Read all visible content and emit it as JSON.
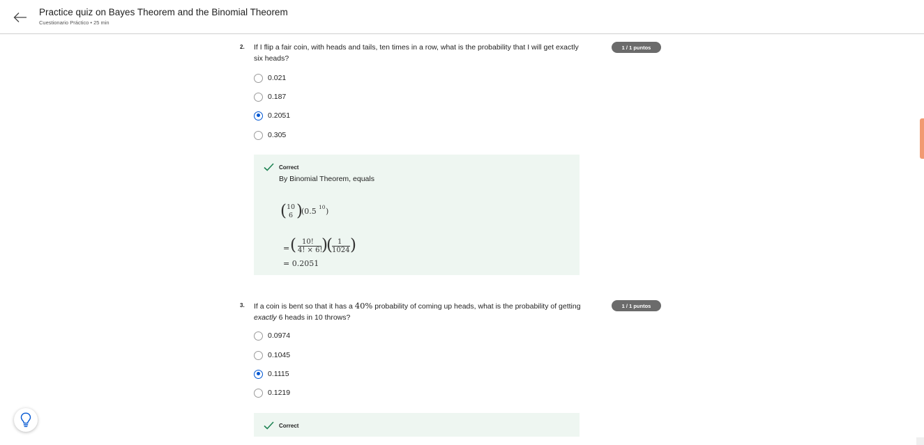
{
  "header": {
    "title": "Practice quiz on Bayes Theorem and the Binomial Theorem",
    "subtitle": "Cuestionario Práctico • 25 min"
  },
  "questions": [
    {
      "number": "2.",
      "text": "If I flip a fair coin, with heads and tails, ten times in a row, what is the probability that I will get exactly six heads?",
      "score": "1 / 1 puntos",
      "options": [
        "0.021",
        "0.187",
        "0.2051",
        "0.305"
      ],
      "selected": "0.2051",
      "feedback": {
        "status": "Correct",
        "text": "By Binomial Theorem, equals",
        "math": {
          "binom_top": "10",
          "binom_bottom": "6",
          "power_expr": "(0.5",
          "power_exp": "10",
          "power_close": ")",
          "eq1": "=",
          "frac1_num": "10!",
          "frac1_den": "4! × 6!",
          "frac2_num": "1",
          "frac2_den": "1024",
          "result": "= 0.2051"
        }
      }
    },
    {
      "number": "3.",
      "text_parts": {
        "a": "If a coin is bent so that it has a ",
        "math": "40%",
        "b": " probability of coming up heads, what is the probability of getting ",
        "em": "exactly",
        "c": " 6 heads in 10 throws?"
      },
      "score": "1 / 1 puntos",
      "options": [
        "0.0974",
        "0.1045",
        "0.1115",
        "0.1219"
      ],
      "selected": "0.1115",
      "feedback": {
        "status": "Correct"
      }
    }
  ],
  "colors": {
    "accent": "#0056d2",
    "correct": "#1f8354",
    "feedback_bg": "#eef6f1",
    "badge_bg": "#6b6b6b",
    "scroll_thumb": "#f19a72"
  },
  "icons": {
    "back": "arrow-left-icon",
    "correct": "checkmark-icon",
    "help": "lightbulb-icon"
  }
}
